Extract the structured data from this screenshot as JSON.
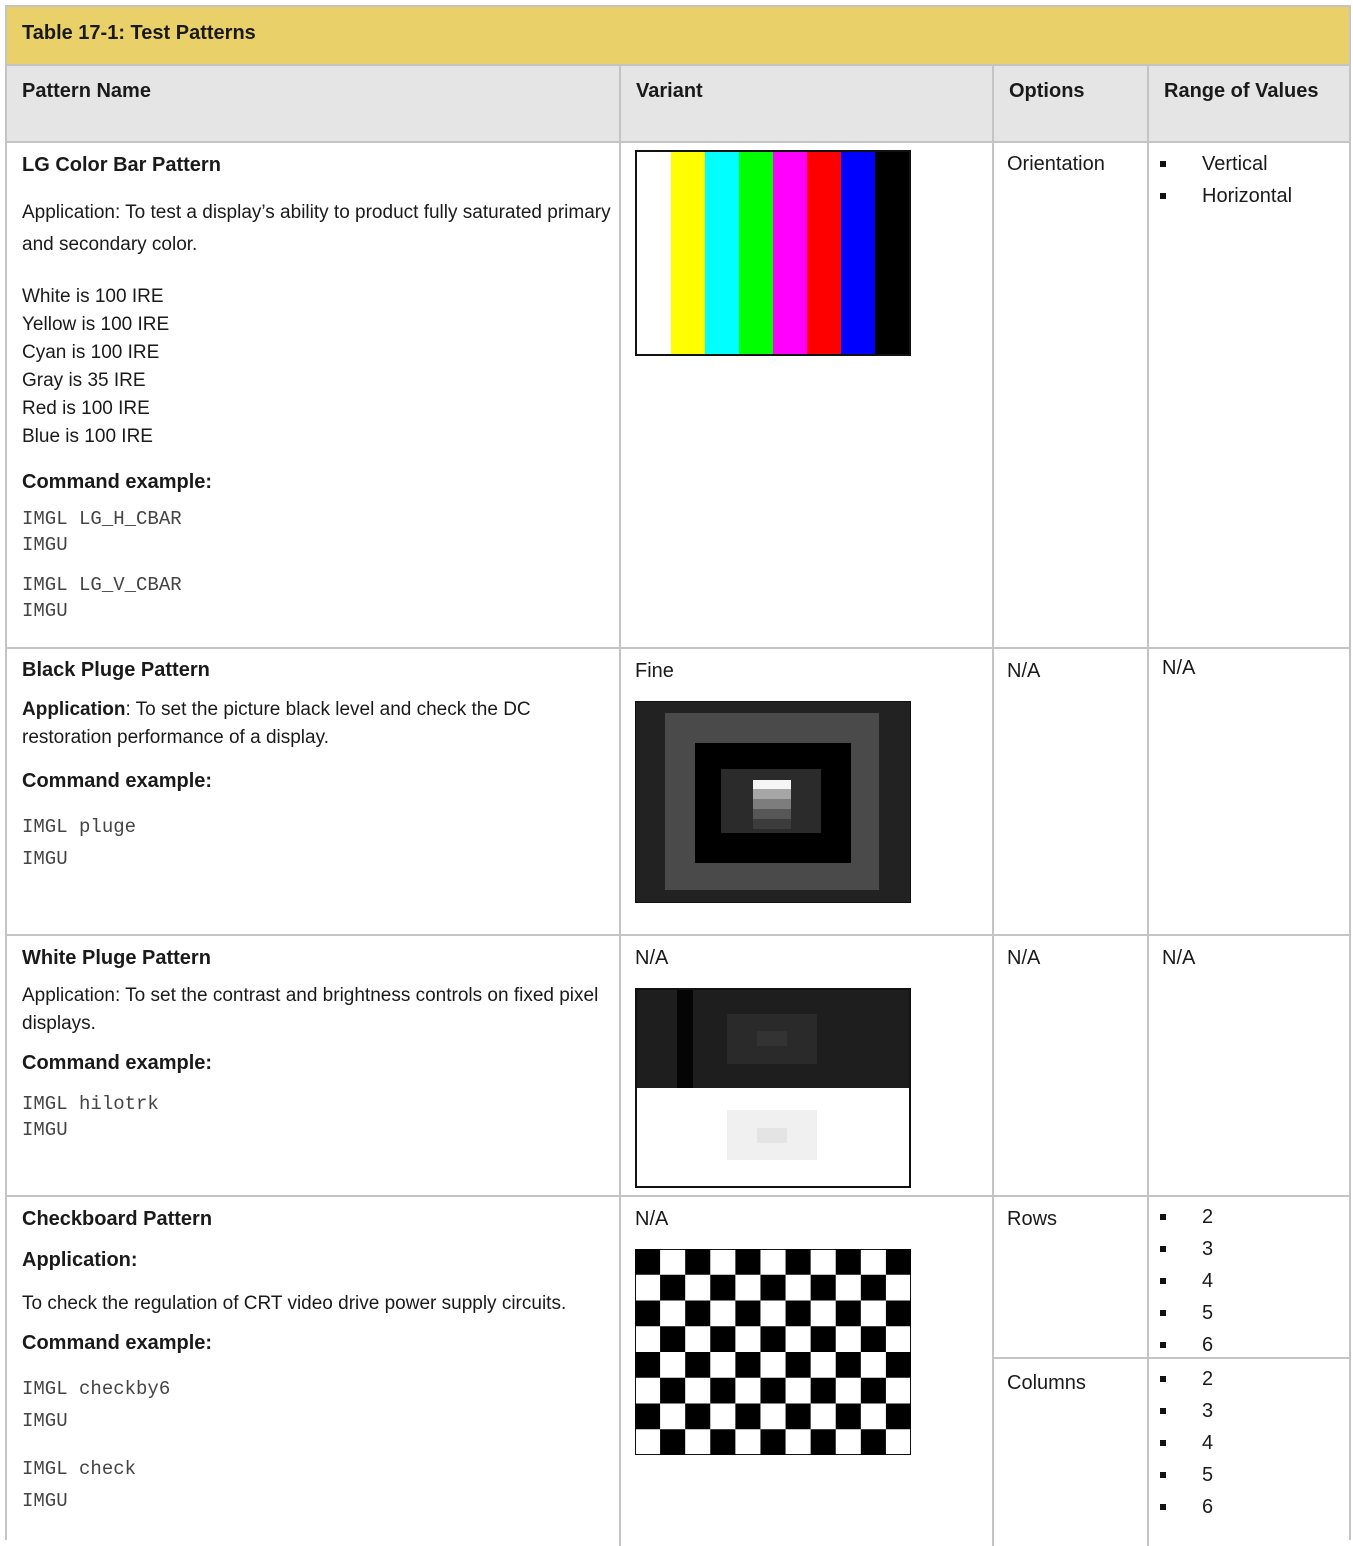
{
  "title": "Table 17-1: Test Patterns",
  "headers": {
    "name": "Pattern Name",
    "variant": "Variant",
    "options": "Options",
    "range": "Range of Values"
  },
  "rows": [
    {
      "name": "LG Color Bar Pattern",
      "application": "Application: To test a display’s ability to product fully saturated primary and secondary color.",
      "levels": [
        "White is 100 IRE",
        "Yellow is 100 IRE",
        "Cyan is 100 IRE",
        "Gray is 35 IRE",
        "Red is 100 IRE",
        "Blue is 100 IRE"
      ],
      "cmd_label": "Command example:",
      "commands": [
        "IMGL LG_H_CBAR",
        "IMGU",
        "IMGL LG_V_CBAR",
        "IMGU"
      ],
      "option": "Orientation",
      "range": [
        "Vertical",
        "Horizontal"
      ],
      "bar_colors": [
        "#ffffff",
        "#ffff00",
        "#00ffff",
        "#00ff00",
        "#ff00ff",
        "#ff0000",
        "#0000ff",
        "#000000"
      ]
    },
    {
      "name": "Black Pluge Pattern",
      "app_bold": "Application",
      "app_rest": ": To set the picture black level and check the DC restoration performance of a display.",
      "cmd_label": "Command example:",
      "commands": [
        "IMGL pluge",
        "IMGU"
      ],
      "variant": "Fine",
      "option": "N/A",
      "range": "N/A"
    },
    {
      "name": "White Pluge Pattern",
      "application": "Application: To set the contrast and brightness controls on fixed pixel displays.",
      "cmd_label": "Command example:",
      "commands": [
        "IMGL hilotrk",
        "IMGU"
      ],
      "variant": "N/A",
      "option": "N/A",
      "range": "N/A"
    },
    {
      "name": "Checkboard Pattern",
      "app_label": "Application:",
      "application": "To check the regulation of CRT video drive power supply circuits.",
      "cmd_label": "Command example:",
      "commands": [
        "IMGL checkby6",
        "IMGU",
        "IMGL check",
        "IMGU"
      ],
      "variant": "N/A",
      "option_rows": "Rows",
      "rows_range": [
        "2",
        "3",
        "4",
        "5",
        "6"
      ],
      "option_cols": "Columns",
      "cols_range": [
        "2",
        "3",
        "4",
        "5",
        "6"
      ]
    }
  ]
}
